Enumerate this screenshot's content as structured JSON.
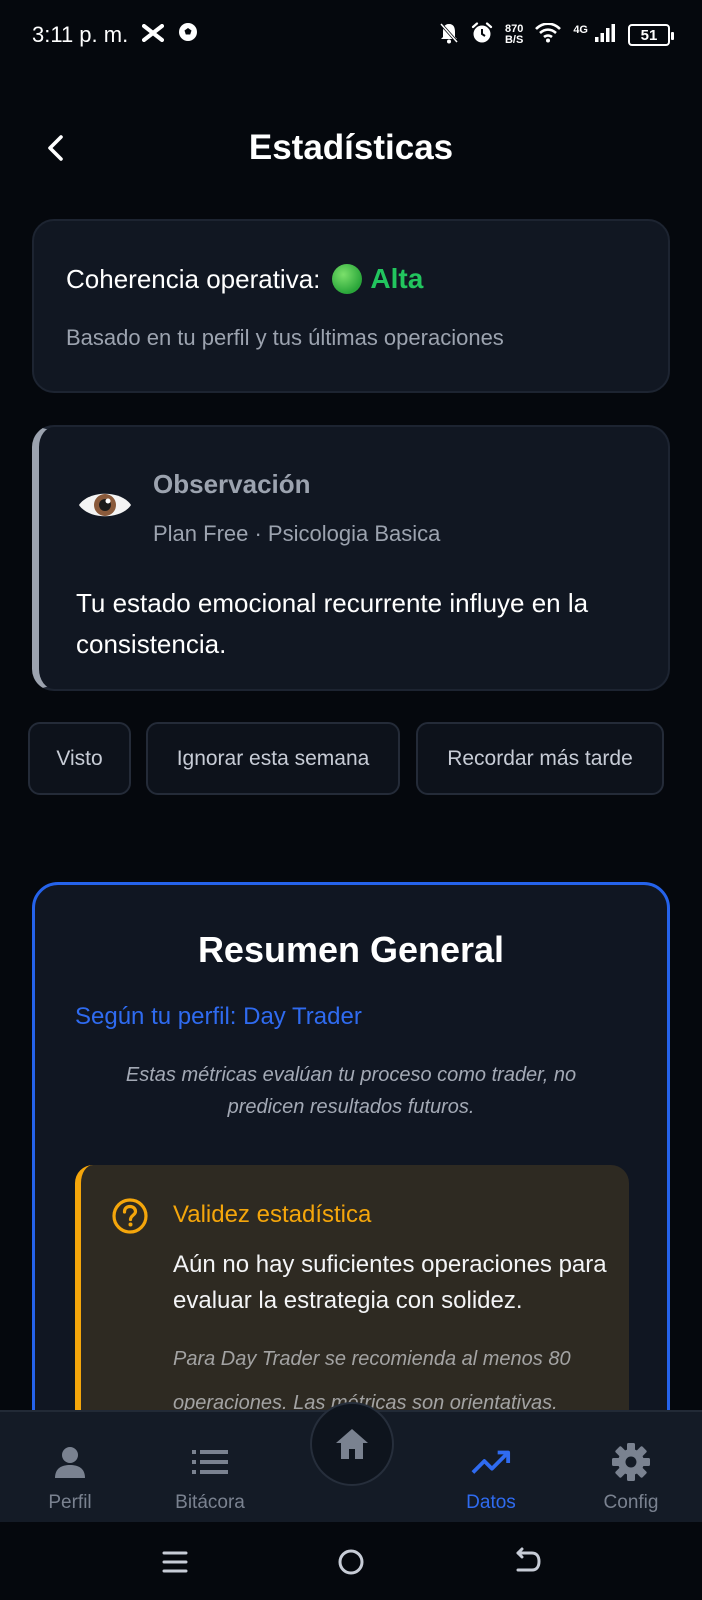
{
  "status_bar": {
    "time": "3:11 p. m.",
    "speed_value": "870",
    "speed_unit": "B/S",
    "network": "4G",
    "battery": "51",
    "icons": [
      "x-app-icon",
      "soccer-ball-icon",
      "mute-bell-icon",
      "alarm-icon",
      "wifi-icon",
      "signal-icon",
      "battery-icon"
    ]
  },
  "header": {
    "title": "Estadísticas",
    "back_icon": "chevron-left-icon"
  },
  "coherence": {
    "label": "Coherencia operativa:",
    "value": "Alta",
    "subtitle": "Basado en tu perfil y tus últimas operaciones",
    "color": "#22c55e"
  },
  "observation": {
    "title": "Observación",
    "meta": "Plan Free · Psicologia Basica",
    "body": "Tu estado emocional recurrente influye en la consistencia.",
    "icon": "eye-icon"
  },
  "actions": {
    "seen": "Visto",
    "ignore": "Ignorar esta semana",
    "remind": "Recordar más tarde"
  },
  "summary": {
    "title": "Resumen General",
    "profile": "Según tu perfil: Day Trader",
    "note": "Estas métricas evalúan tu proceso como trader, no predicen resultados futuros.",
    "accent": "#2563eb",
    "validity": {
      "title": "Validez estadística",
      "body": "Aún no hay suficientes operaciones para evaluar la estrategia con solidez.",
      "small": "Para Day Trader se recomienda al menos 80 operaciones. Las métricas son orientativas.",
      "accent": "#f5a60b",
      "icon": "question-circle-icon"
    }
  },
  "bottom_nav": {
    "items": [
      {
        "label": "Perfil",
        "icon": "person-icon"
      },
      {
        "label": "Bitácora",
        "icon": "list-icon"
      },
      {
        "label": "Datos",
        "icon": "trending-up-icon",
        "active": true
      },
      {
        "label": "Config",
        "icon": "gear-icon"
      }
    ],
    "home_icon": "home-icon",
    "active_color": "#2f6bf0"
  }
}
